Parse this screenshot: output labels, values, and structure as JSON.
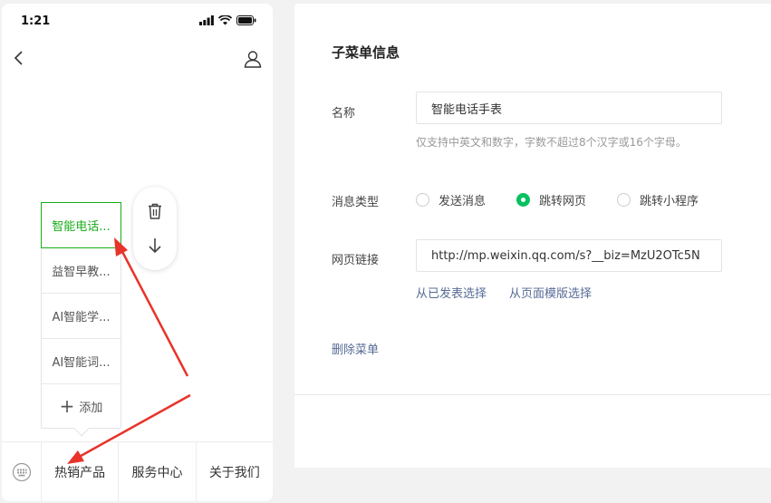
{
  "status_bar": {
    "time": "1:21"
  },
  "submenu": {
    "items": [
      {
        "label": "智能电话..."
      },
      {
        "label": "益智早教..."
      },
      {
        "label": "AI智能学..."
      },
      {
        "label": "AI智能词..."
      }
    ],
    "add_label": "添加"
  },
  "menu_bar": {
    "tabs": [
      {
        "label": "热销产品"
      },
      {
        "label": "服务中心"
      },
      {
        "label": "关于我们"
      }
    ]
  },
  "editor": {
    "title": "子菜单信息",
    "name_label": "名称",
    "name_value": "智能电话手表",
    "name_hint": "仅支持中英文和数字，字数不超过8个汉字或16个字母。",
    "type_label": "消息类型",
    "type_options": [
      {
        "label": "发送消息",
        "checked": false
      },
      {
        "label": "跳转网页",
        "checked": true
      },
      {
        "label": "跳转小程序",
        "checked": false
      }
    ],
    "url_label": "网页链接",
    "url_value": "http://mp.weixin.qq.com/s?__biz=MzU2OTc5N",
    "link_published": "从已发表选择",
    "link_template": "从页面模版选择",
    "delete_label": "删除菜单"
  },
  "colors": {
    "accent_green": "#07c160",
    "link_blue": "#576b95",
    "annotation_red": "#e8332a"
  }
}
